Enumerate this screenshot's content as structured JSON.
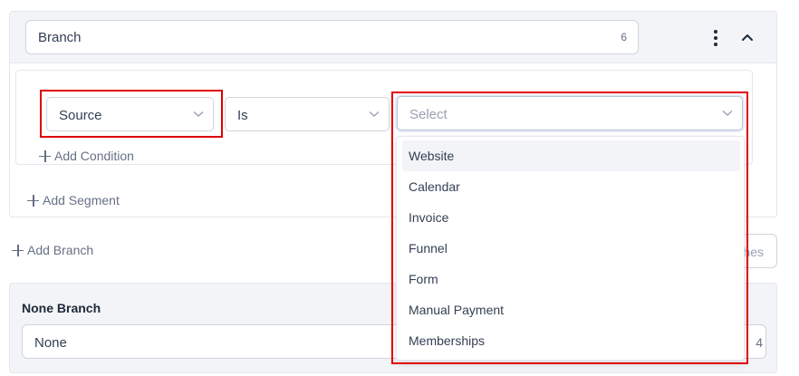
{
  "branch": {
    "name": "Branch",
    "char_count": "6"
  },
  "condition": {
    "field": "Source",
    "operator": "Is",
    "value_placeholder": "Select"
  },
  "links": {
    "add_condition": "Add Condition",
    "add_segment": "Add Segment",
    "add_branch": "Add Branch"
  },
  "side_button": {
    "label": "hes"
  },
  "none_branch": {
    "title": "None Branch",
    "value": "None",
    "char_count": "4"
  },
  "dropdown": {
    "options": [
      "Website",
      "Calendar",
      "Invoice",
      "Funnel",
      "Form",
      "Manual Payment",
      "Memberships"
    ],
    "hovered": "Website"
  },
  "colors": {
    "highlight": "#e00000",
    "header_bg": "#f2f4f7",
    "border": "#d0d5dd"
  }
}
